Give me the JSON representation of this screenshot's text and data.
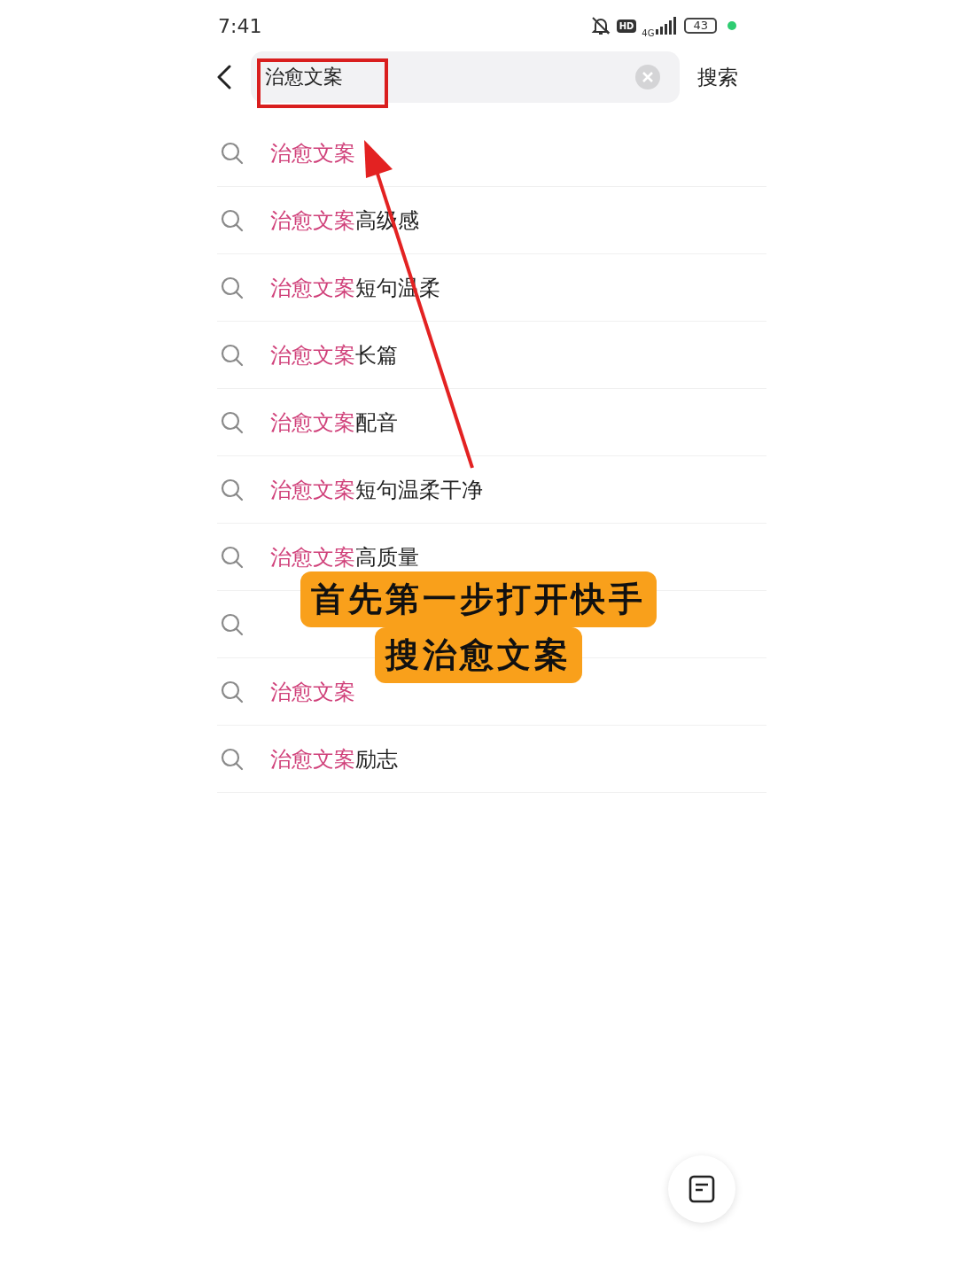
{
  "status_bar": {
    "time": "7:41",
    "hd": "HD",
    "network": "4G",
    "battery": "43"
  },
  "search": {
    "value": "治愈文案",
    "button": "搜索"
  },
  "suggestions": [
    {
      "kind": "text",
      "highlight": "治愈文案"
    },
    {
      "kind": "text",
      "highlight": "治愈文案",
      "rest": "高级感"
    },
    {
      "kind": "text",
      "highlight": "治愈文案",
      "rest": "短句温柔"
    },
    {
      "kind": "text",
      "highlight": "治愈文案",
      "rest": "长篇"
    },
    {
      "kind": "text",
      "highlight": "治愈文案",
      "rest": "配音"
    },
    {
      "kind": "text",
      "highlight": "治愈文案",
      "rest": "短句温柔干净"
    },
    {
      "kind": "text",
      "highlight": "治愈文案",
      "rest": "高质量"
    },
    {
      "kind": "covered"
    },
    {
      "kind": "text",
      "highlight": "治愈文案"
    },
    {
      "kind": "text",
      "highlight": "治愈文案",
      "rest": "励志"
    }
  ],
  "caption": [
    "首先第一步打开快手",
    "搜治愈文案"
  ]
}
